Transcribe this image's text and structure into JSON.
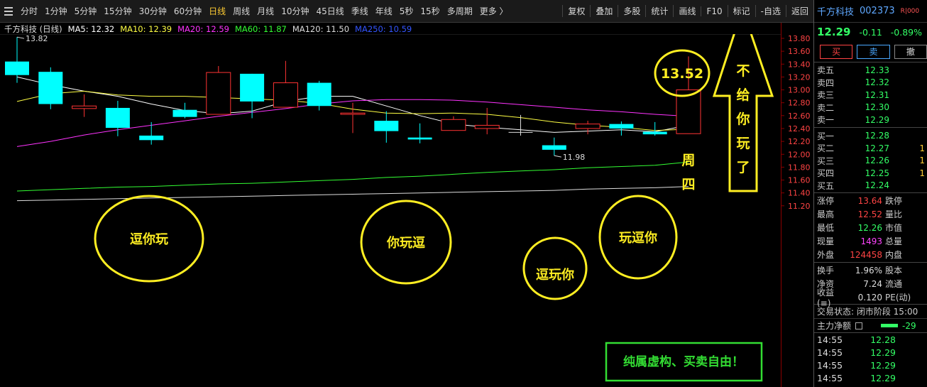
{
  "toolbar": {
    "periods": [
      "分时",
      "1分钟",
      "5分钟",
      "15分钟",
      "30分钟",
      "60分钟",
      "日线",
      "周线",
      "月线",
      "10分钟",
      "45日线",
      "季线",
      "年线",
      "5秒",
      "15秒",
      "多周期",
      "更多 〉"
    ],
    "active_period": "日线",
    "actions": [
      "复权",
      "叠加",
      "多股",
      "统计",
      "画线",
      "F10",
      "标记",
      "-自选",
      "返回"
    ]
  },
  "ma_legend": {
    "stock_label": "千方科技 (日线)",
    "items": [
      {
        "label": "MA5: 12.32",
        "color": "#ffffff"
      },
      {
        "label": "MA10: 12.39",
        "color": "#ffff44"
      },
      {
        "label": "MA20: 12.59",
        "color": "#ff33ff"
      },
      {
        "label": "MA60: 11.87",
        "color": "#33ff33"
      },
      {
        "label": "MA120: 11.50",
        "color": "#dddddd"
      },
      {
        "label": "MA250: 10.59",
        "color": "#3355ff"
      }
    ]
  },
  "chart_data": {
    "type": "candlestick",
    "ylim": [
      11.1,
      13.9
    ],
    "y_ticks": [
      "13.80",
      "13.60",
      "13.40",
      "13.20",
      "13.00",
      "12.80",
      "12.60",
      "12.40",
      "12.20",
      "12.00",
      "11.80",
      "11.60",
      "11.40",
      "11.20"
    ],
    "candles": [
      {
        "open": 13.44,
        "close": 13.23,
        "high": 13.82,
        "low": 13.11,
        "color": "cyan"
      },
      {
        "open": 13.28,
        "close": 12.78,
        "high": 13.35,
        "low": 12.7,
        "color": "cyan"
      },
      {
        "open": 12.71,
        "close": 12.75,
        "high": 12.93,
        "low": 12.58,
        "color": "red"
      },
      {
        "open": 12.72,
        "close": 12.41,
        "high": 12.83,
        "low": 12.28,
        "color": "cyan"
      },
      {
        "open": 12.29,
        "close": 12.22,
        "high": 12.5,
        "low": 12.15,
        "color": "cyan"
      },
      {
        "open": 12.69,
        "close": 12.58,
        "high": 12.8,
        "low": 12.56,
        "color": "cyan"
      },
      {
        "open": 12.62,
        "close": 13.27,
        "high": 13.37,
        "low": 12.62,
        "color": "red"
      },
      {
        "open": 13.25,
        "close": 12.82,
        "high": 13.25,
        "low": 12.56,
        "color": "cyan"
      },
      {
        "open": 12.73,
        "close": 13.11,
        "high": 13.45,
        "low": 12.73,
        "color": "red"
      },
      {
        "open": 13.11,
        "close": 12.75,
        "high": 13.14,
        "low": 12.68,
        "color": "cyan"
      },
      {
        "open": 12.62,
        "close": 12.64,
        "high": 12.8,
        "low": 12.33,
        "color": "red"
      },
      {
        "open": 12.52,
        "close": 12.36,
        "high": 12.67,
        "low": 12.18,
        "color": "cyan"
      },
      {
        "open": 12.26,
        "close": 12.23,
        "high": 12.48,
        "low": 12.17,
        "color": "cyan"
      },
      {
        "open": 12.37,
        "close": 12.54,
        "high": 12.59,
        "low": 12.37,
        "color": "red"
      },
      {
        "open": 12.4,
        "close": 12.45,
        "high": 12.72,
        "low": 12.31,
        "color": "red"
      },
      {
        "open": 12.34,
        "close": 12.34,
        "high": 12.61,
        "low": 12.29,
        "color": "white"
      },
      {
        "open": 12.14,
        "close": 12.07,
        "high": 12.26,
        "low": 11.98,
        "color": "cyan"
      },
      {
        "open": 12.4,
        "close": 12.47,
        "high": 12.52,
        "low": 12.31,
        "color": "red"
      },
      {
        "open": 12.47,
        "close": 12.4,
        "high": 12.51,
        "low": 12.29,
        "color": "cyan"
      },
      {
        "open": 12.35,
        "close": 12.31,
        "high": 12.5,
        "low": 12.29,
        "color": "cyan"
      },
      {
        "open": 12.32,
        "close": 13.0,
        "high": 13.52,
        "low": 12.32,
        "color": "red"
      }
    ],
    "ma_lines": [
      {
        "name": "MA5",
        "color": "#ffffff",
        "values": [
          13.2,
          13.08,
          12.98,
          12.9,
          12.78,
          12.68,
          12.63,
          12.67,
          12.82,
          12.9,
          12.9,
          12.75,
          12.6,
          12.47,
          12.42,
          12.38,
          12.34,
          12.36,
          12.38,
          12.35,
          12.45
        ]
      },
      {
        "name": "MA10",
        "color": "#ffff44",
        "values": [
          12.82,
          12.94,
          12.98,
          12.92,
          12.9,
          12.9,
          12.88,
          12.86,
          12.84,
          12.79,
          12.7,
          12.64,
          12.63,
          12.64,
          12.62,
          12.57,
          12.5,
          12.45,
          12.42,
          12.37,
          12.39
        ]
      },
      {
        "name": "MA20",
        "color": "#ff33ff",
        "values": [
          12.12,
          12.2,
          12.3,
          12.38,
          12.45,
          12.52,
          12.59,
          12.65,
          12.71,
          12.78,
          12.83,
          12.85,
          12.85,
          12.84,
          12.81,
          12.77,
          12.73,
          12.69,
          12.66,
          12.62,
          12.59
        ]
      },
      {
        "name": "MA60",
        "color": "#33ff33",
        "values": [
          11.43,
          11.45,
          11.47,
          11.49,
          11.5,
          11.52,
          11.54,
          11.55,
          11.57,
          11.59,
          11.61,
          11.64,
          11.66,
          11.69,
          11.72,
          11.74,
          11.76,
          11.79,
          11.81,
          11.83,
          11.88
        ]
      },
      {
        "name": "MA120",
        "color": "#dddddd",
        "values": [
          11.28,
          11.29,
          11.3,
          11.31,
          11.32,
          11.33,
          11.34,
          11.35,
          11.36,
          11.37,
          11.38,
          11.39,
          11.4,
          11.41,
          11.42,
          11.43,
          11.44,
          11.46,
          11.47,
          11.48,
          11.5
        ]
      }
    ],
    "markers": [
      {
        "label": "13.82",
        "candle": 0,
        "value": 13.82
      },
      {
        "label": "11.98",
        "candle": 16,
        "value": 11.98
      }
    ],
    "annotations": [
      {
        "type": "ellipse",
        "text": "逗你玩",
        "color": "#ffee22"
      },
      {
        "type": "ellipse",
        "text": "你玩逗",
        "color": "#ffee22"
      },
      {
        "type": "ellipse",
        "text": "逗玩你",
        "color": "#ffee22"
      },
      {
        "type": "ellipse",
        "text": "玩逗你",
        "color": "#ffee22"
      },
      {
        "type": "ellipse",
        "text": "13.52",
        "color": "#ffee22"
      },
      {
        "type": "box",
        "text": "周\n四",
        "color": "#ffee22"
      },
      {
        "type": "arrow",
        "text": "不\n给\n你\n玩\n了",
        "color": "#ffee22"
      },
      {
        "type": "box",
        "text": "纯属虚构、买卖自由！",
        "color": "#33dd33"
      }
    ]
  },
  "right_panel": {
    "stock_name": "千方科技",
    "stock_code": "002373",
    "badge": "R|000",
    "price": "12.29",
    "change": "-0.11",
    "change_pct": "-0.89%",
    "buttons": [
      "买",
      "卖",
      "撤"
    ],
    "asks": [
      {
        "label": "卖五",
        "price": "12.33",
        "qty": ""
      },
      {
        "label": "卖四",
        "price": "12.32",
        "qty": ""
      },
      {
        "label": "卖三",
        "price": "12.31",
        "qty": ""
      },
      {
        "label": "卖二",
        "price": "12.30",
        "qty": ""
      },
      {
        "label": "卖一",
        "price": "12.29",
        "qty": ""
      }
    ],
    "bids": [
      {
        "label": "买一",
        "price": "12.28",
        "qty": ""
      },
      {
        "label": "买二",
        "price": "12.27",
        "qty": "1"
      },
      {
        "label": "买三",
        "price": "12.26",
        "qty": "1"
      },
      {
        "label": "买四",
        "price": "12.25",
        "qty": "1"
      },
      {
        "label": "买五",
        "price": "12.24",
        "qty": ""
      }
    ],
    "stats": [
      {
        "l": "涨停",
        "v": "13.64",
        "vc": "red",
        "l2": "跌停"
      },
      {
        "l": "最高",
        "v": "12.52",
        "vc": "red",
        "l2": "量比"
      },
      {
        "l": "最低",
        "v": "12.26",
        "vc": "grn",
        "l2": "市值"
      },
      {
        "l": "现量",
        "v": "1493",
        "vc": "mag",
        "l2": "总量"
      },
      {
        "l": "外盘",
        "v": "124458",
        "vc": "red",
        "l2": "内盘"
      }
    ],
    "stats2": [
      {
        "l": "换手",
        "v": "1.96%",
        "vc": "wht",
        "l2": "股本"
      },
      {
        "l": "净资",
        "v": "7.24",
        "vc": "wht",
        "l2": "流通"
      },
      {
        "l": "收益(≡)",
        "v": "0.120",
        "vc": "wht",
        "l2": "PE(动)"
      }
    ],
    "trade_status": "交易状态: 闭市阶段 15:00",
    "main_flow_label": "主力净额",
    "main_flow_value": "-29",
    "ticks": [
      {
        "t": "14:55",
        "v": "12.28"
      },
      {
        "t": "14:55",
        "v": "12.29"
      },
      {
        "t": "14:55",
        "v": "12.29"
      },
      {
        "t": "14:55",
        "v": "12.29"
      }
    ]
  }
}
